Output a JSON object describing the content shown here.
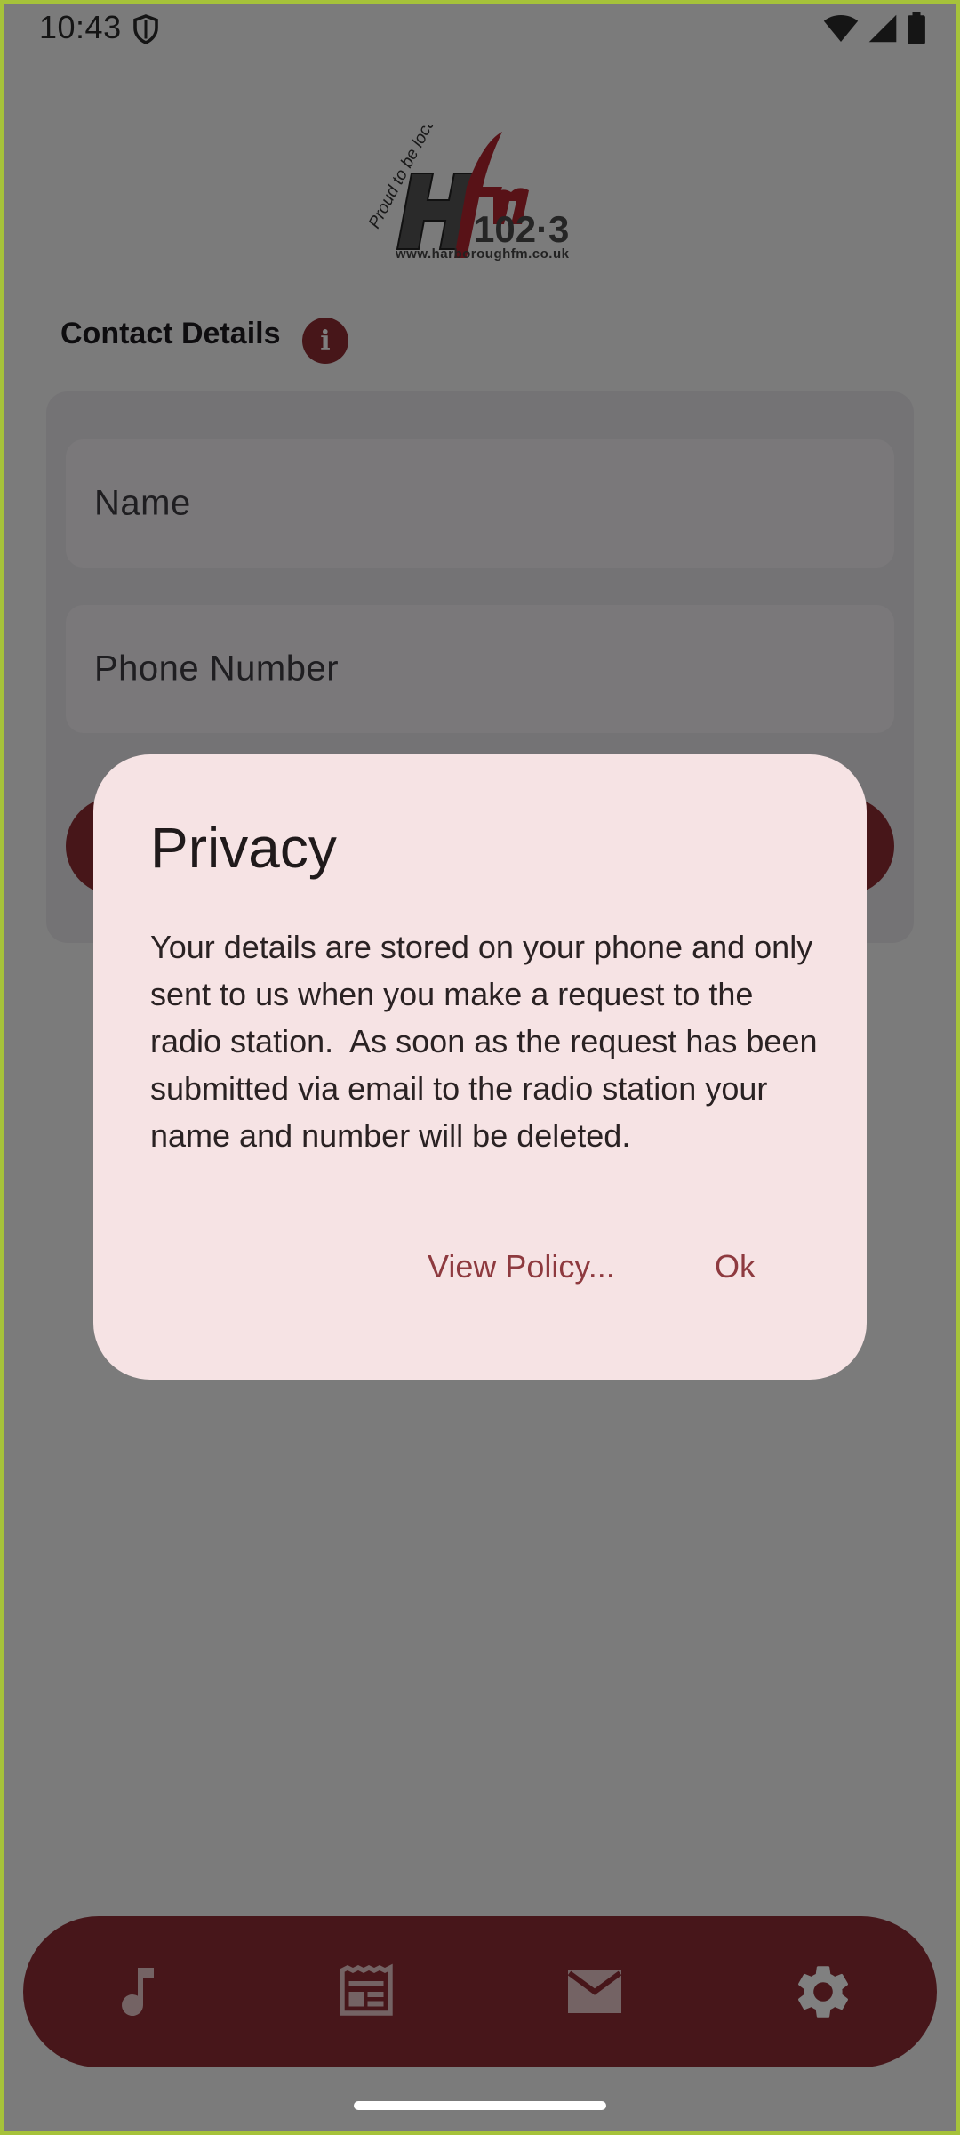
{
  "status_bar": {
    "time": "10:43",
    "icons": [
      "shield-icon",
      "wifi-icon",
      "cellular-icon",
      "battery-icon"
    ]
  },
  "logo": {
    "tagline": "Proud to be local!",
    "brand": "Hfm",
    "frequency": "102·3",
    "url": "www.harboroughfm.co.uk"
  },
  "contact": {
    "title": "Contact Details",
    "info_icon": "info-icon",
    "name_placeholder": "Name",
    "phone_placeholder": "Phone Number"
  },
  "dialog": {
    "title": "Privacy",
    "body": "Your details are stored on your phone and only sent to us when you make a request to the radio station.  As soon as the request has been submitted via email to the radio station your name and number will be deleted.",
    "view_policy_label": "View Policy...",
    "ok_label": "Ok"
  },
  "bottom_nav": {
    "items": [
      "music-note-icon",
      "newspaper-icon",
      "mail-icon",
      "settings-gear-icon"
    ],
    "selected": "settings-gear-icon"
  },
  "colors": {
    "primary": "#8e2c33",
    "dialog_background": "#f6e3e4",
    "dialog_button_text": "#8e3a3f"
  }
}
